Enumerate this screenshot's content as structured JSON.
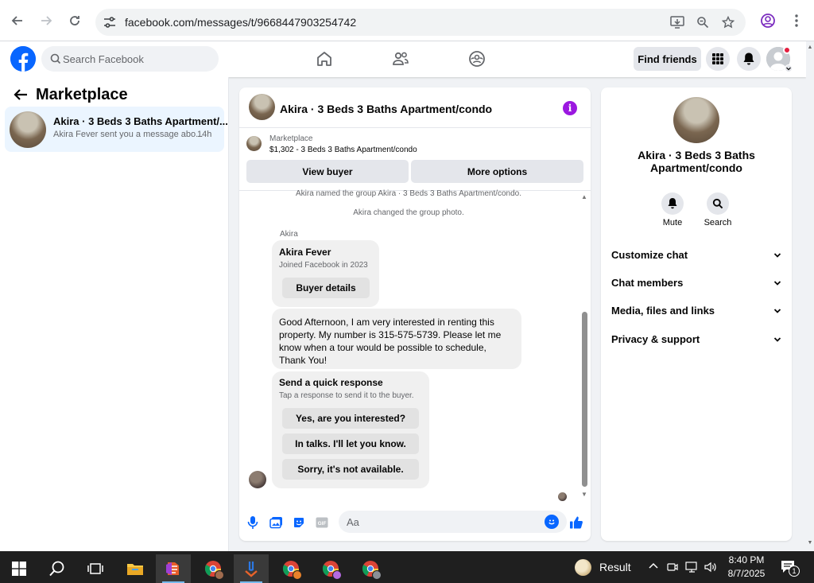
{
  "browser": {
    "url": "facebook.com/messages/t/9668447903254742"
  },
  "fb": {
    "search_placeholder": "Search Facebook",
    "find_friends": "Find friends"
  },
  "left": {
    "title": "Marketplace",
    "conversation": {
      "name": "Akira · 3 Beds 3 Baths Apartment/...",
      "snippet": "Akira Fever sent you a message abo...",
      "time": "14h"
    }
  },
  "chat": {
    "title": "Akira · 3 Beds 3 Baths Apartment/condo",
    "marketplace_label": "Marketplace",
    "listing": "$1,302 - 3 Beds 3 Baths Apartment/condo",
    "view_buyer": "View buyer",
    "more_options": "More options",
    "system_1": "Akira named the group Akira · 3 Beds 3 Baths Apartment/condo.",
    "system_2": "Akira changed the group photo.",
    "sender": "Akira",
    "card_name": "Akira Fever",
    "card_joined": "Joined Facebook in 2023",
    "buyer_details": "Buyer details",
    "message": "Good Afternoon, I am very interested in renting this property. My number is 315-575-5739. Please let me know when a tour would be possible to schedule, Thank You!",
    "quick_title": "Send a quick response",
    "quick_sub": "Tap a response to send it to the buyer.",
    "quick_responses": [
      "Yes, are you interested?",
      "In talks. I'll let you know.",
      "Sorry, it's not available."
    ],
    "composer_placeholder": "Aa"
  },
  "info": {
    "name": "Akira · 3 Beds 3 Baths Apartment/condo",
    "mute": "Mute",
    "search": "Search",
    "sections": [
      "Customize chat",
      "Chat members",
      "Media, files and links",
      "Privacy & support"
    ]
  },
  "taskbar": {
    "result_label": "Result",
    "time": "8:40 PM",
    "date": "8/7/2025",
    "notif_count": "1"
  },
  "colors": {
    "fb_blue": "#0866ff",
    "info_purple": "#9b18e0",
    "selected_row": "#ebf5ff"
  },
  "icons": [
    "back-arrow-icon",
    "forward-arrow-icon",
    "reload-icon",
    "tune-icon",
    "install-icon",
    "zoom-icon",
    "star-icon",
    "profile-icon",
    "menu-dots-icon",
    "facebook-logo",
    "search-icon",
    "home-icon",
    "friends-icon",
    "groups-icon",
    "grid-menu-icon",
    "bell-icon",
    "info-icon",
    "mic-icon",
    "photo-icon",
    "sticker-icon",
    "gif-icon",
    "emoji-icon",
    "like-icon",
    "chevron-down-icon",
    "windows-start-icon",
    "taskbar-search-icon",
    "task-view-icon",
    "file-explorer-icon",
    "chrome-icon"
  ]
}
